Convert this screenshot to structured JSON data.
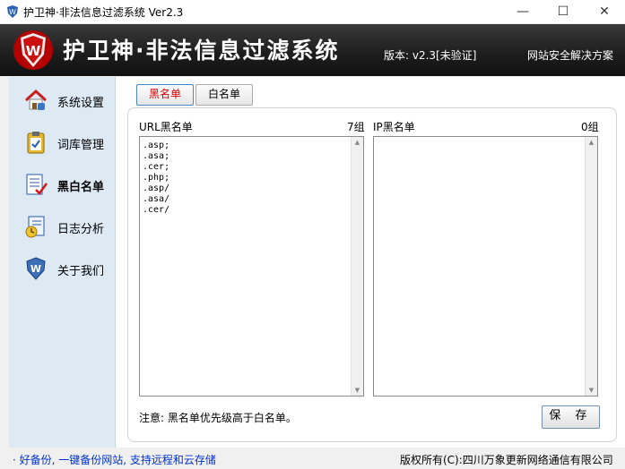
{
  "window": {
    "title": "护卫神·非法信息过滤系统 Ver2.3",
    "controls": [
      "minimize-icon",
      "maximize-icon",
      "close-icon"
    ]
  },
  "header": {
    "app_title": "护卫神·非法信息过滤系统",
    "version": "版本: v2.3[未验证]",
    "slogan": "网站安全解决方案"
  },
  "sidebar": {
    "items": [
      {
        "label": "系统设置",
        "icon": "house-settings-icon"
      },
      {
        "label": "词库管理",
        "icon": "clipboard-icon"
      },
      {
        "label": "黑白名单",
        "icon": "list-check-icon",
        "active": true
      },
      {
        "label": "日志分析",
        "icon": "log-clock-icon"
      },
      {
        "label": "关于我们",
        "icon": "shield-logo-icon"
      }
    ]
  },
  "tabs": [
    {
      "label": "黑名单",
      "active": true
    },
    {
      "label": "白名单",
      "active": false
    }
  ],
  "url_panel": {
    "label": "URL黑名单",
    "count": "7组",
    "entries": [
      ".asp;",
      ".asa;",
      ".cer;",
      ".php;",
      ".asp/",
      ".asa/",
      ".cer/"
    ]
  },
  "ip_panel": {
    "label": "IP黑名单",
    "count": "0组",
    "entries": []
  },
  "note": "注意: 黑名单优先级高于白名单。",
  "save_label": "保 存",
  "status": {
    "left": "· 好备份, 一键备份网站, 支持远程和云存储",
    "right": "版权所有(C):四川万象更新网络通信有限公司"
  },
  "colors": {
    "accent_red": "#d40000",
    "header_bg": "#1c1c1c",
    "sidebar_bg": "#dde9f3",
    "link_blue": "#0033cc"
  }
}
